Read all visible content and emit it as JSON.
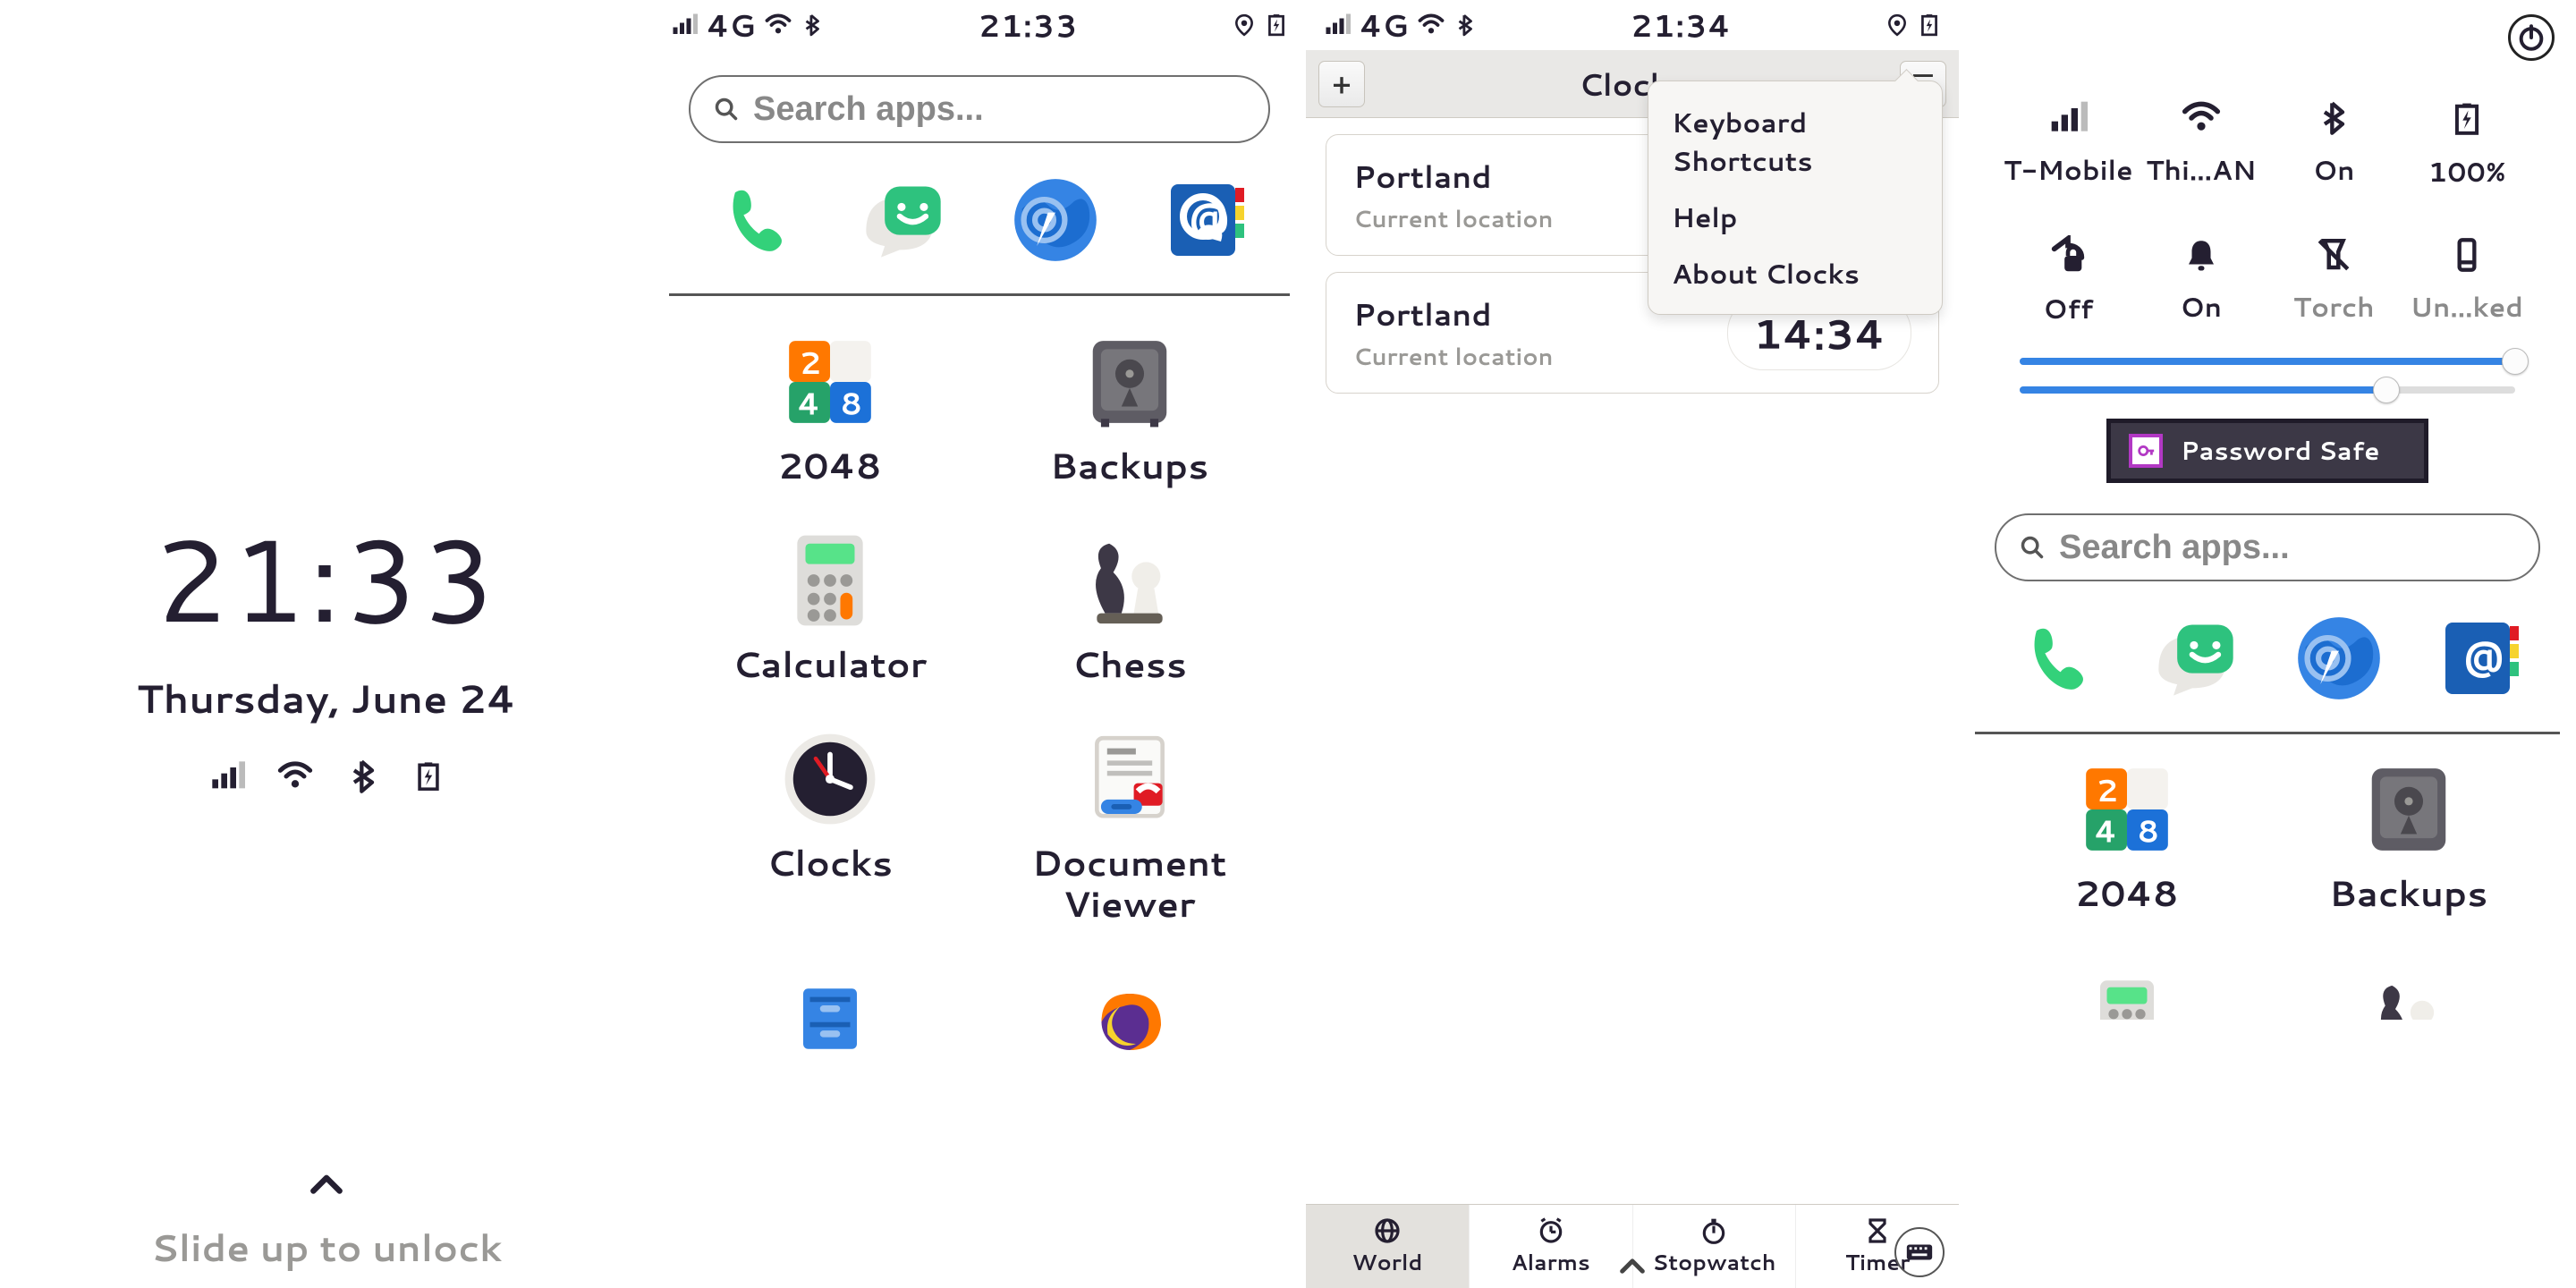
{
  "lock": {
    "time": "21:33",
    "date": "Thursday, June 24",
    "hint": "Slide up to unlock"
  },
  "statusbar": {
    "network": "4G",
    "time_p2": "21:33",
    "time_p3": "21:34"
  },
  "search_placeholder": "Search apps...",
  "apps": {
    "a0": "2048",
    "a1": "Backups",
    "a2": "Calculator",
    "a3": "Chess",
    "a4": "Clocks",
    "a5": "Document Viewer"
  },
  "clocks": {
    "title": "Clocks",
    "menu": {
      "m0": "Keyboard Shortcuts",
      "m1": "Help",
      "m2": "About Clocks"
    },
    "rows": {
      "city1": "Portland",
      "cur": "Current location",
      "city2": "Portland",
      "time2": "14:34"
    },
    "tabs": {
      "t0": "World",
      "t1": "Alarms",
      "t2": "Stopwatch",
      "t3": "Timer"
    }
  },
  "qs": {
    "cell": "T-Mobile",
    "wifi": "Thi...AN",
    "bt": "On",
    "bat": "100%",
    "rot": "Off",
    "dnd": "On",
    "torch": "Torch",
    "dock": "Un...ked"
  },
  "notif": {
    "title": "Password Safe"
  },
  "p4apps": {
    "a0": "2048",
    "a1": "Backups"
  }
}
